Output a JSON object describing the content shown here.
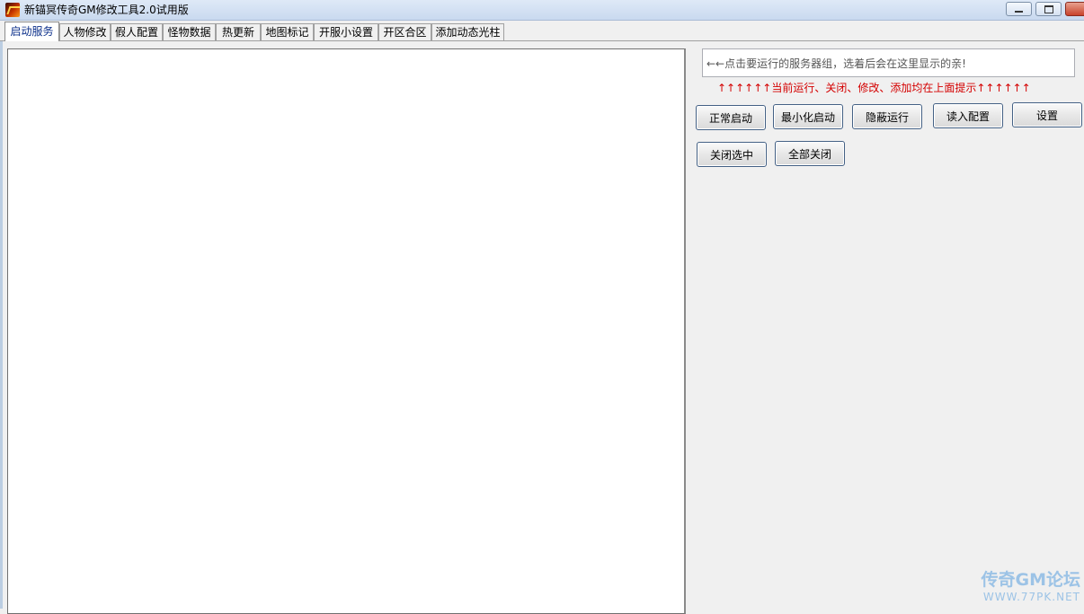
{
  "window": {
    "title": "新锚冥传奇GM修改工具2.0试用版"
  },
  "tabs": [
    {
      "label": "启动服务",
      "active": true
    },
    {
      "label": "人物修改",
      "active": false
    },
    {
      "label": "假人配置",
      "active": false
    },
    {
      "label": "怪物数据",
      "active": false
    },
    {
      "label": "热更新",
      "active": false
    },
    {
      "label": "地图标记",
      "active": false
    },
    {
      "label": "开服小设置",
      "active": false
    },
    {
      "label": "开区合区",
      "active": false
    },
    {
      "label": "添加动态光柱",
      "active": false
    }
  ],
  "server_panel": {
    "selected_text": "←←点击要运行的服务器组，选着后会在这里显示的亲!",
    "hint": "↑↑↑↑↑↑当前运行、关闭、修改、添加均在上面提示↑↑↑↑↑↑"
  },
  "buttons": {
    "normal_start": "正常启动",
    "minimize_start": "最小化启动",
    "hidden_run": "隐蔽运行",
    "read_config": "读入配置",
    "settings": "设置",
    "close_selected": "关闭选中",
    "close_all": "全部关闭"
  },
  "watermark": {
    "name": "传奇GM论坛",
    "url": "WWW.77PK.NET"
  },
  "colors": {
    "hint_red": "#d40000",
    "tab_active_text": "#0b2f8a",
    "button_border": "#446185"
  }
}
